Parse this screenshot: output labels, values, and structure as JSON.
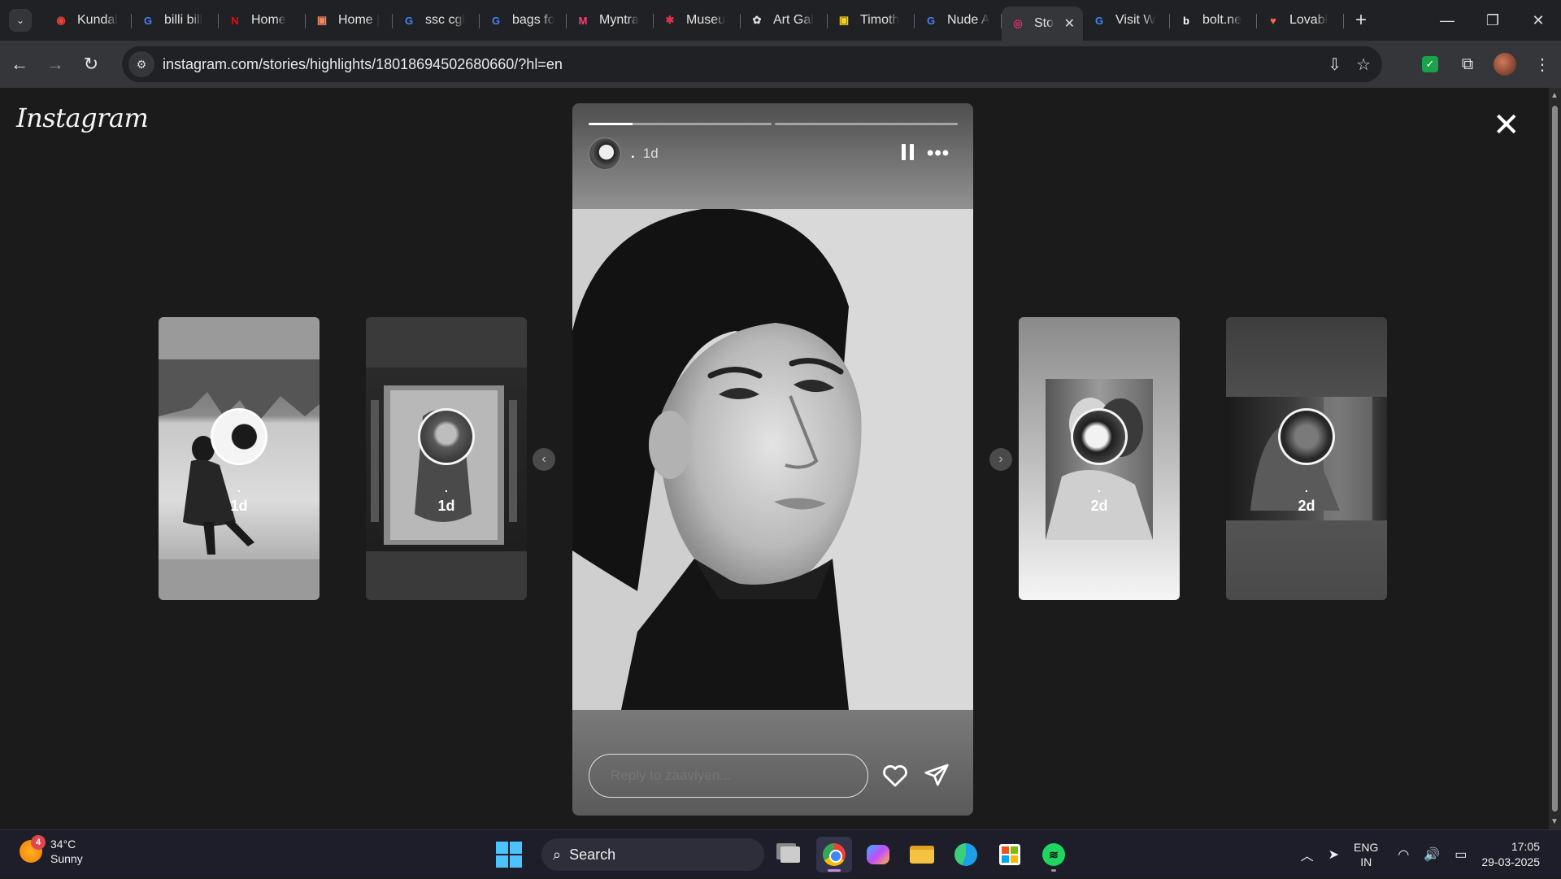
{
  "browser": {
    "tabs": [
      {
        "title": "Kundal",
        "icon": "maps-pin-icon",
        "color": "#ea4335",
        "glyph": "◉"
      },
      {
        "title": "billi bill",
        "icon": "google-icon",
        "color": "#4285f4",
        "glyph": "G"
      },
      {
        "title": "Home",
        "icon": "netflix-icon",
        "color": "#e50914",
        "glyph": "N"
      },
      {
        "title": "Home |",
        "icon": "site-icon",
        "color": "#f08a5d",
        "glyph": "▣"
      },
      {
        "title": "ssc cgl",
        "icon": "google-icon",
        "color": "#4285f4",
        "glyph": "G"
      },
      {
        "title": "bags fo",
        "icon": "google-icon",
        "color": "#4285f4",
        "glyph": "G"
      },
      {
        "title": "Myntra",
        "icon": "myntra-icon",
        "color": "#ff3f6c",
        "glyph": "M"
      },
      {
        "title": "Museu",
        "icon": "asterisk-icon",
        "color": "#e0314f",
        "glyph": "✱"
      },
      {
        "title": "Art Gal",
        "icon": "openai-icon",
        "color": "#dddddd",
        "glyph": "✿"
      },
      {
        "title": "Timoth",
        "icon": "site-icon",
        "color": "#f7d21c",
        "glyph": "▣"
      },
      {
        "title": "Nude A",
        "icon": "google-icon",
        "color": "#4285f4",
        "glyph": "G"
      },
      {
        "title": "Sto",
        "icon": "instagram-icon",
        "color": "#e1306c",
        "glyph": "◎",
        "active": true
      },
      {
        "title": "Visit W",
        "icon": "google-icon",
        "color": "#4285f4",
        "glyph": "G"
      },
      {
        "title": "bolt.ne",
        "icon": "bolt-icon",
        "color": "#ffffff",
        "glyph": "b"
      },
      {
        "title": "Lovabl",
        "icon": "lovable-heart-icon",
        "color": "#ff6b3d",
        "glyph": "♥"
      }
    ],
    "url": "instagram.com/stories/highlights/18018694502680660/?hl=en"
  },
  "page": {
    "logo": "Instagram"
  },
  "story": {
    "username": ".",
    "time": "1d",
    "progress": [
      0.24,
      0
    ],
    "reply_placeholder": "Reply to zaaviyen..."
  },
  "previews": {
    "left": [
      {
        "name": ".",
        "time": "1d"
      },
      {
        "name": ".",
        "time": "1d"
      }
    ],
    "right": [
      {
        "name": ".",
        "time": "2d"
      },
      {
        "name": ".",
        "time": "2d"
      }
    ]
  },
  "taskbar": {
    "weather_badge": "4",
    "temperature": "34°C",
    "condition": "Sunny",
    "search_label": "Search",
    "lang_line1": "ENG",
    "lang_line2": "IN",
    "time": "17:05",
    "date": "29-03-2025"
  }
}
